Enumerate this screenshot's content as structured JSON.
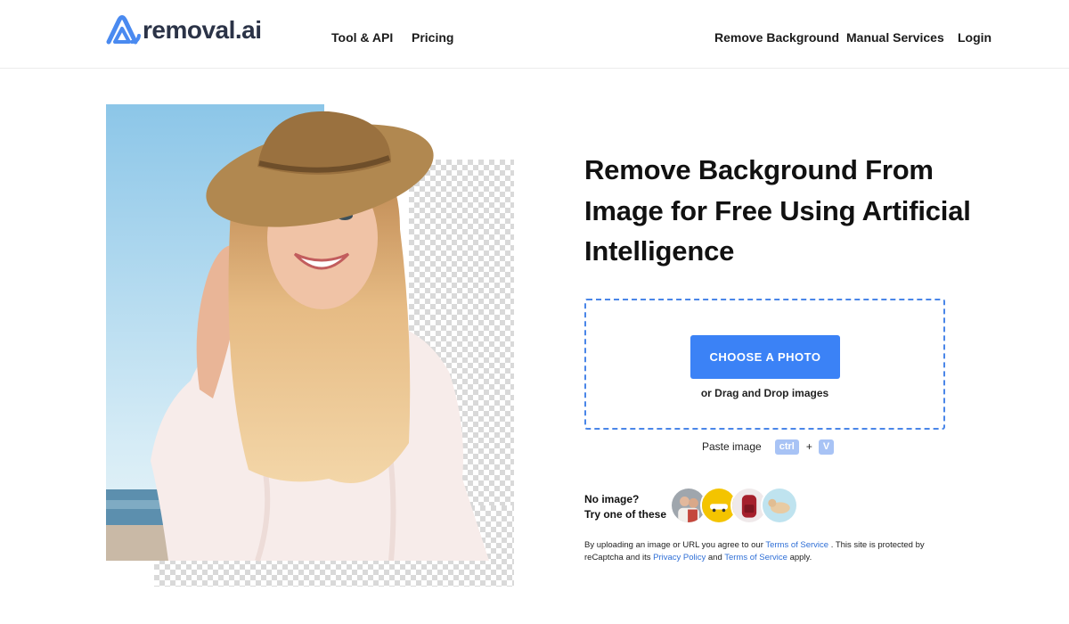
{
  "header": {
    "logo_text": "removal.ai",
    "nav_left": [
      "Tool & API",
      "Pricing"
    ],
    "nav_right": [
      "Remove Background",
      "Manual Services",
      "Login"
    ]
  },
  "hero": {
    "headline": "Remove Background From Image for Free Using Artificial Intelligence"
  },
  "upload": {
    "button_label": "CHOOSE A PHOTO",
    "drag_text": "or Drag and Drop images",
    "paste_label": "Paste image",
    "key_ctrl": "ctrl",
    "key_plus": "+",
    "key_v": "V"
  },
  "samples": {
    "line1": "No image?",
    "line2": "Try one of these",
    "items": [
      "couple-photo",
      "yellow-car-photo",
      "red-backpack-photo",
      "dog-photo"
    ]
  },
  "legal": {
    "part1": "By uploading an image or URL you agree to our",
    "terms_link": "Terms of Service",
    "part2": ". This site is protected by reCaptcha and its",
    "privacy_link": "Privacy Policy",
    "part3": "and its",
    "and_text": "and",
    "terms_link2": "Terms of Service",
    "part4": "apply."
  },
  "colors": {
    "accent": "#3b82f6",
    "dashed_border": "#4a86e8",
    "link": "#2f6fd6",
    "key_bg": "#a8c3f5"
  }
}
